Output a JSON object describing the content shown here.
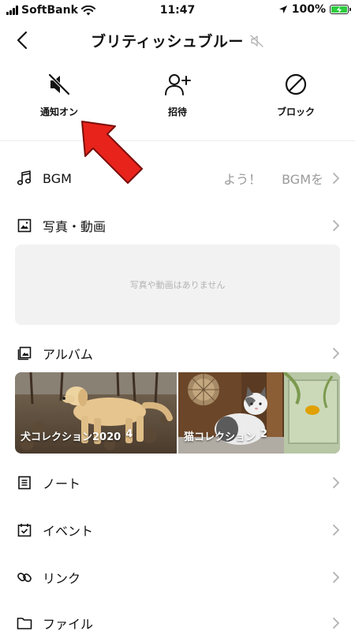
{
  "status_bar": {
    "carrier": "SoftBank",
    "time": "11:47",
    "battery_percent": "100%",
    "icons": [
      "signal-icon",
      "wifi-icon",
      "location-icon",
      "battery-charging-icon"
    ]
  },
  "header": {
    "title": "ブリティッシュブルー",
    "back_icon": "chevron-left-icon",
    "muted_icon": "speaker-muted-icon"
  },
  "actions": [
    {
      "label": "通知オン",
      "icon": "speaker-muted-icon"
    },
    {
      "label": "招待",
      "icon": "add-person-icon"
    },
    {
      "label": "ブロック",
      "icon": "block-icon"
    }
  ],
  "menu": {
    "bgm": {
      "label": "BGM",
      "extra_1": "よう！",
      "extra_2": "BGMを",
      "icon": "music-note-icon"
    },
    "photos": {
      "label": "写真・動画",
      "icon": "photo-icon",
      "empty_text": "写真や動画はありません"
    },
    "album": {
      "label": "アルバム",
      "icon": "album-icon"
    },
    "note": {
      "label": "ノート",
      "icon": "note-icon"
    },
    "event": {
      "label": "イベント",
      "icon": "calendar-icon"
    },
    "link": {
      "label": "リンク",
      "icon": "link-icon"
    },
    "file": {
      "label": "ファイル",
      "icon": "folder-icon"
    }
  },
  "albums": [
    {
      "title": "犬コレクション2020",
      "count": "4"
    },
    {
      "title": "猫コレクション",
      "count": "2"
    }
  ],
  "colors": {
    "accent_arrow": "#e8231b",
    "battery": "#2ecc40",
    "muted_text": "#9a9a9a",
    "empty_bg": "#f2f2f2"
  }
}
